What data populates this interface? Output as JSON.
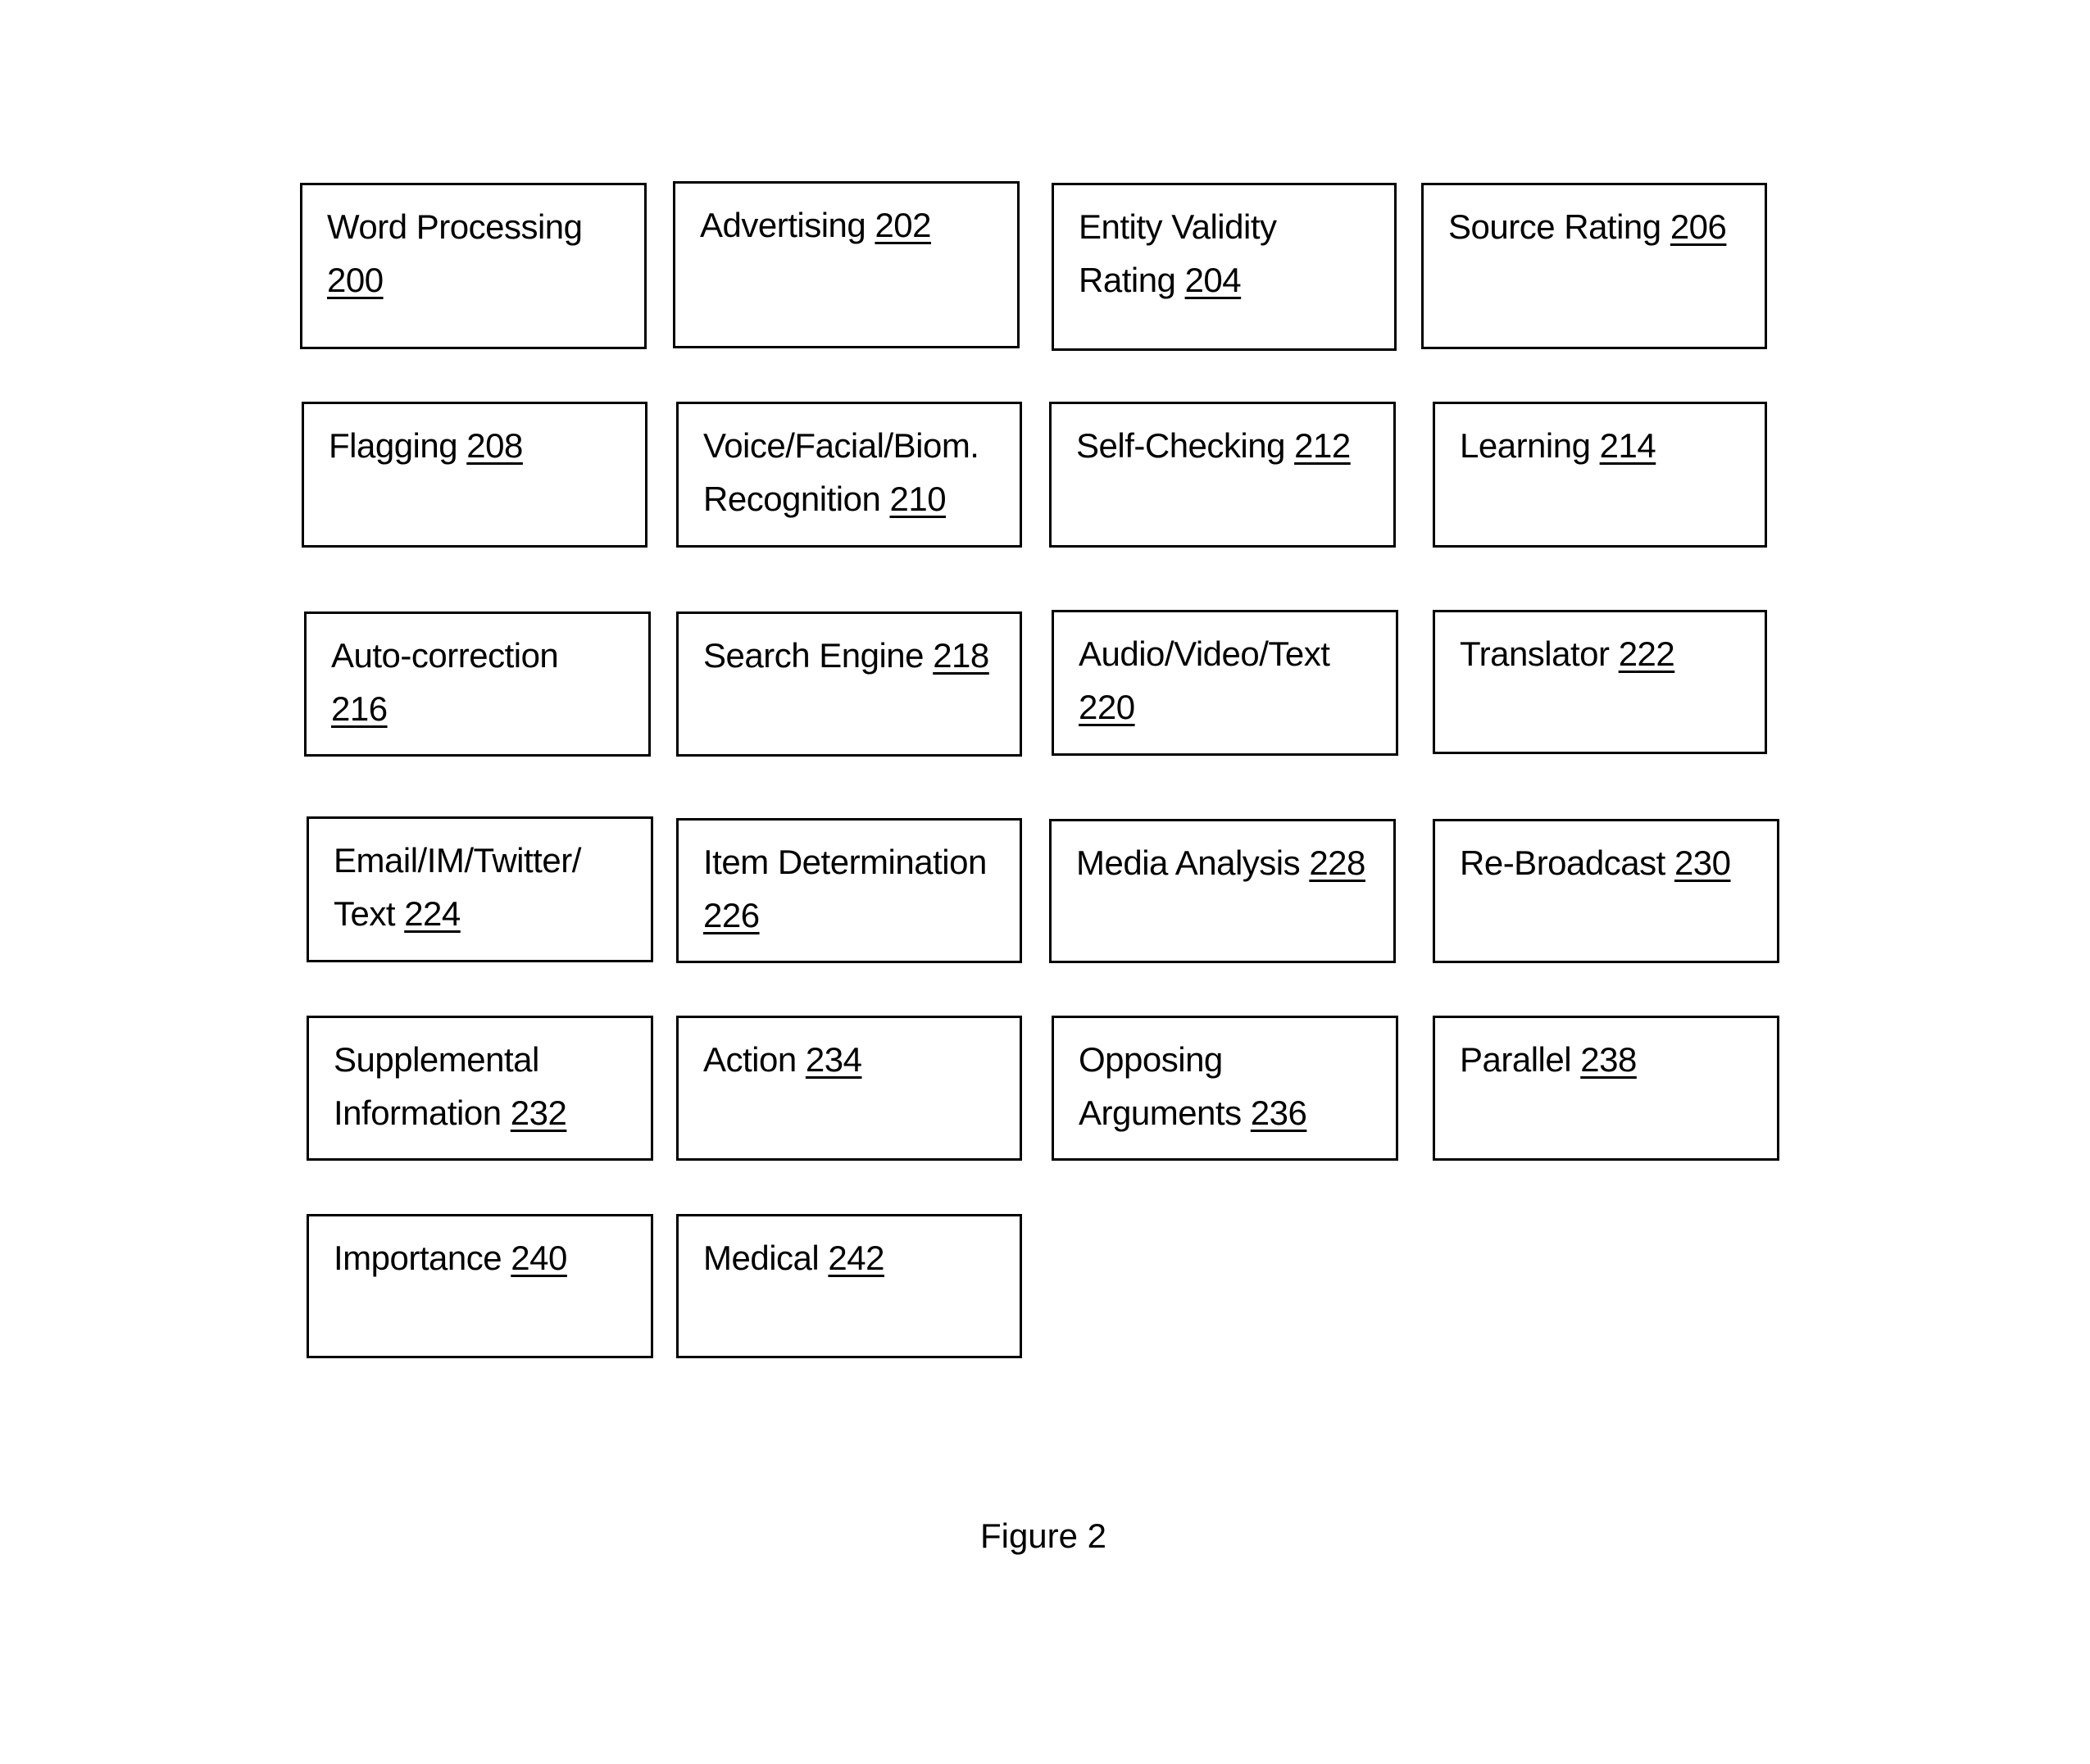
{
  "figure": {
    "caption": "Figure 2",
    "boxes": [
      {
        "label": "Word Processing",
        "ref": "200",
        "break": true
      },
      {
        "label": "Advertising",
        "ref": "202",
        "break": false
      },
      {
        "label": "Entity Validity Rating",
        "ref": "204",
        "break": false
      },
      {
        "label": "Source Rating",
        "ref": "206",
        "break": false
      },
      {
        "label": "Flagging",
        "ref": "208",
        "break": false
      },
      {
        "label": "Voice/Facial/Biom. Recognition",
        "ref": "210",
        "break": false
      },
      {
        "label": "Self-Checking",
        "ref": "212",
        "break": false
      },
      {
        "label": "Learning",
        "ref": "214",
        "break": false
      },
      {
        "label": "Auto-correction",
        "ref": "216",
        "break": true
      },
      {
        "label": "Search Engine",
        "ref": "218",
        "break": false
      },
      {
        "label": "Audio/Video/Text",
        "ref": "220",
        "break": true
      },
      {
        "label": "Translator",
        "ref": "222",
        "break": false
      },
      {
        "label": "Email/IM/Twitter/ Text",
        "ref": "224",
        "break": false
      },
      {
        "label": "Item Determination",
        "ref": "226",
        "break": false
      },
      {
        "label": "Media Analysis",
        "ref": "228",
        "break": false
      },
      {
        "label": "Re-Broadcast",
        "ref": "230",
        "break": false
      },
      {
        "label": "Supplemental Information",
        "ref": "232",
        "break": false
      },
      {
        "label": "Action",
        "ref": "234",
        "break": false
      },
      {
        "label": "Opposing Arguments",
        "ref": "236",
        "break": false
      },
      {
        "label": "Parallel",
        "ref": "238",
        "break": false
      },
      {
        "label": "Importance",
        "ref": "240",
        "break": false
      },
      {
        "label": "Medical",
        "ref": "242",
        "break": false
      }
    ]
  }
}
